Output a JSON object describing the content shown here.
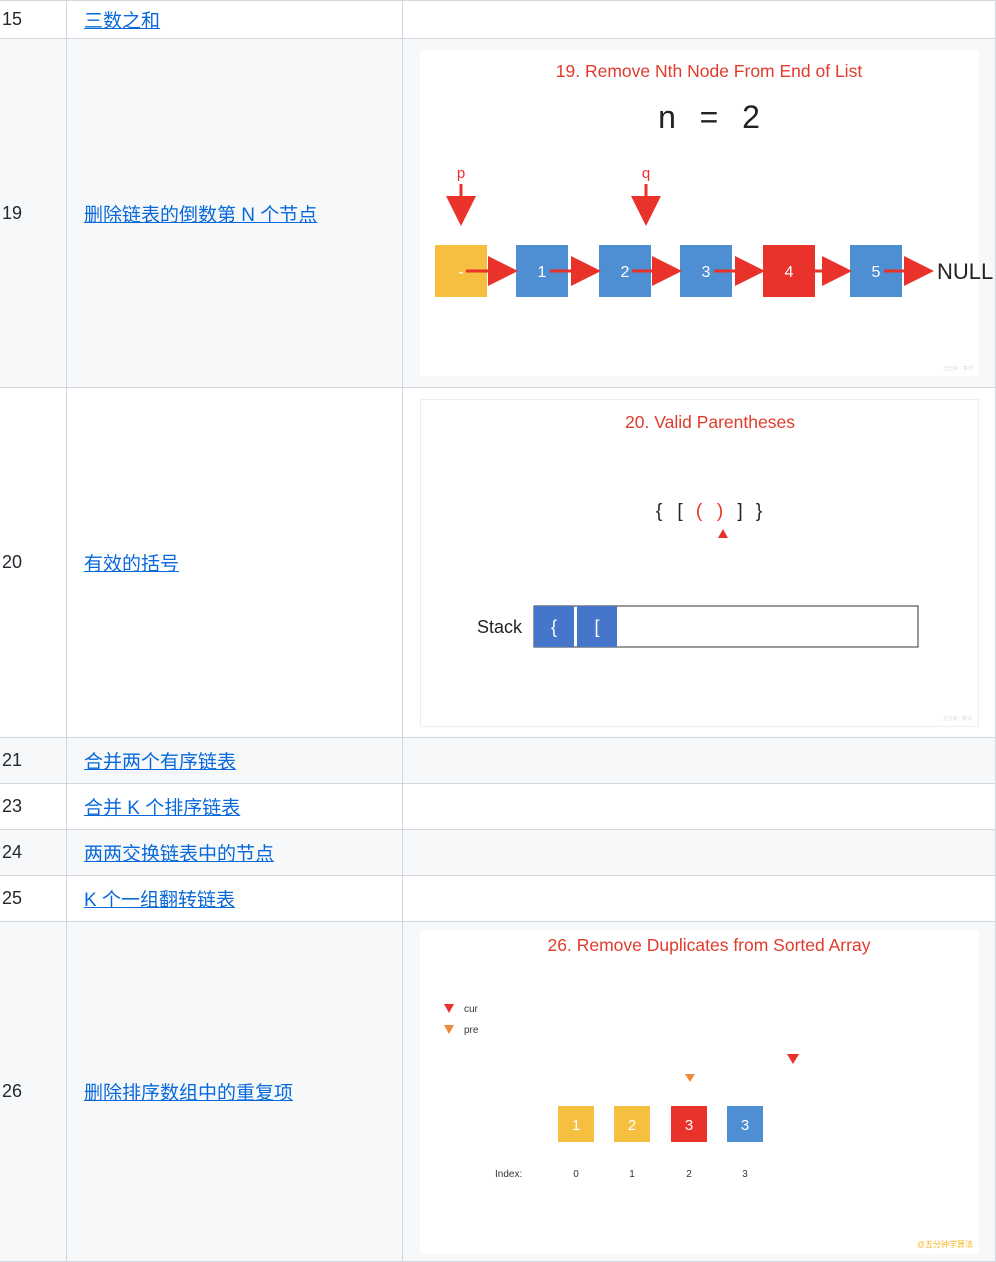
{
  "rows": [
    {
      "num": "15",
      "title": "三数之和"
    },
    {
      "num": "19",
      "title": "删除链表的倒数第 N 个节点"
    },
    {
      "num": "20",
      "title": "有效的括号"
    },
    {
      "num": "21",
      "title": "合并两个有序链表"
    },
    {
      "num": "23",
      "title": "合并 K 个排序链表"
    },
    {
      "num": "24",
      "title": "两两交换链表中的节点"
    },
    {
      "num": "25",
      "title": "K 个一组翻转链表"
    },
    {
      "num": "26",
      "title": "删除排序数组中的重复项"
    }
  ],
  "anim19": {
    "title": "19. Remove Nth Node From End of List",
    "n_label": "n",
    "equals": "=",
    "n_value": "2",
    "pointer_p": "p",
    "pointer_q": "q",
    "nodes": [
      "-",
      "1",
      "2",
      "3",
      "4",
      "5"
    ],
    "null_label": "NULL",
    "watermark": "五分钟 · 算法",
    "colors": {
      "dummy": "#f6bf3f",
      "node": "#4e8fd3",
      "target": "#e8322a",
      "arrow": "#e8322a"
    }
  },
  "anim20": {
    "title": "20. Valid Parentheses",
    "brackets": [
      "{",
      "[",
      "(",
      ")",
      "]",
      "}"
    ],
    "stack_label": "Stack",
    "stack_items": [
      "{",
      "["
    ],
    "watermark": "五分钟 · 算法",
    "colors": {
      "highlight": "#e8322a",
      "stack": "#4676c9"
    }
  },
  "anim26": {
    "title": "26. Remove Duplicates from Sorted Array",
    "legend_cur": "cur",
    "legend_pre": "pre",
    "values": [
      "1",
      "2",
      "3",
      "3"
    ],
    "index_label": "Index:",
    "indices": [
      "0",
      "1",
      "2",
      "3"
    ],
    "watermark": "@五分钟学算法",
    "colors": {
      "yellow": "#f6bf3f",
      "red": "#e8322a",
      "blue": "#4e8fd3",
      "cur": "#e8322a",
      "pre": "#f08a3a"
    }
  }
}
